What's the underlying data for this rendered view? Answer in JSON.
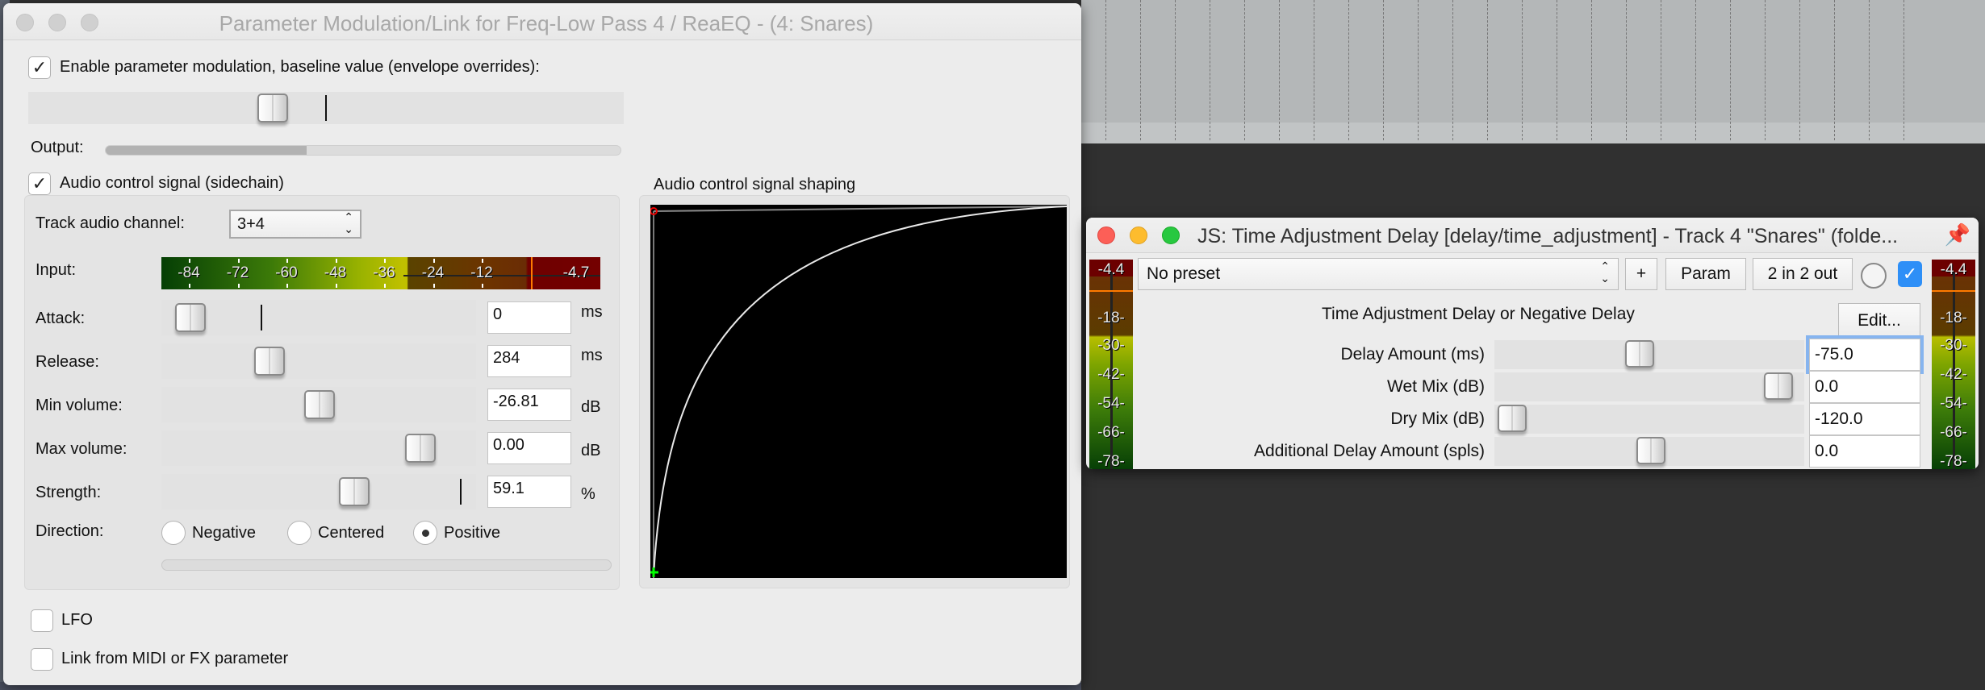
{
  "main_window": {
    "title": "Parameter Modulation/Link for Freq-Low Pass 4 / ReaEQ - (4: Snares)",
    "enable_modulation": {
      "label": "Enable parameter modulation, baseline value (envelope overrides):",
      "checked": true
    },
    "baseline_slider": {
      "value_fraction": 0.41
    },
    "output": {
      "label": "Output:",
      "fill_fraction": 0.39
    },
    "audio_control": {
      "label": "Audio control signal (sidechain)",
      "checked": true,
      "track_audio_channel": {
        "label": "Track audio channel:",
        "value": "3+4"
      },
      "input_meter": {
        "label": "Input:",
        "scale_labels": [
          "-84",
          "-72",
          "-60",
          "-48",
          "-36",
          "-24",
          "-12",
          "-4.7"
        ],
        "peak_value": "-4.7"
      },
      "params": [
        {
          "label": "Attack:",
          "value": "0",
          "unit": "ms",
          "slider_fraction": 0.06
        },
        {
          "label": "Release:",
          "value": "284",
          "unit": "ms",
          "slider_fraction": 0.31
        },
        {
          "label": "Min volume:",
          "value": "-26.81",
          "unit": "dB",
          "slider_fraction": 0.47
        },
        {
          "label": "Max volume:",
          "value": "0.00",
          "unit": "dB",
          "slider_fraction": 0.79
        },
        {
          "label": "Strength:",
          "value": "59.1",
          "unit": "%",
          "slider_fraction": 0.58
        }
      ],
      "direction": {
        "label": "Direction:",
        "options": [
          "Negative",
          "Centered",
          "Positive"
        ],
        "selected": "Positive"
      }
    },
    "shaping": {
      "label": "Audio control signal shaping"
    },
    "lfo": {
      "label": "LFO",
      "checked": false
    },
    "link": {
      "label": "Link from MIDI or FX parameter",
      "checked": false
    }
  },
  "js_window": {
    "title": "JS: Time Adjustment Delay [delay/time_adjustment] - Track 4 \"Snares\" (folde...",
    "preset": "No preset",
    "add_preset_label": "+",
    "param_label": "Param",
    "io_label": "2 in 2 out",
    "enabled": true,
    "description": "Time Adjustment Delay or Negative Delay",
    "edit_label": "Edit...",
    "meter_labels": [
      "-4.4",
      "-18-",
      "-30-",
      "-42-",
      "-54-",
      "-66-",
      "-78-"
    ],
    "params": [
      {
        "label": "Delay Amount (ms)",
        "value": "-75.0",
        "slider_fraction": 0.46
      },
      {
        "label": "Wet Mix (dB)",
        "value": "0.0",
        "slider_fraction": 0.96
      },
      {
        "label": "Dry Mix (dB)",
        "value": "-120.0",
        "slider_fraction": 0.0
      },
      {
        "label": "Additional Delay Amount (spls)",
        "value": "0.0",
        "slider_fraction": 0.5
      }
    ]
  }
}
